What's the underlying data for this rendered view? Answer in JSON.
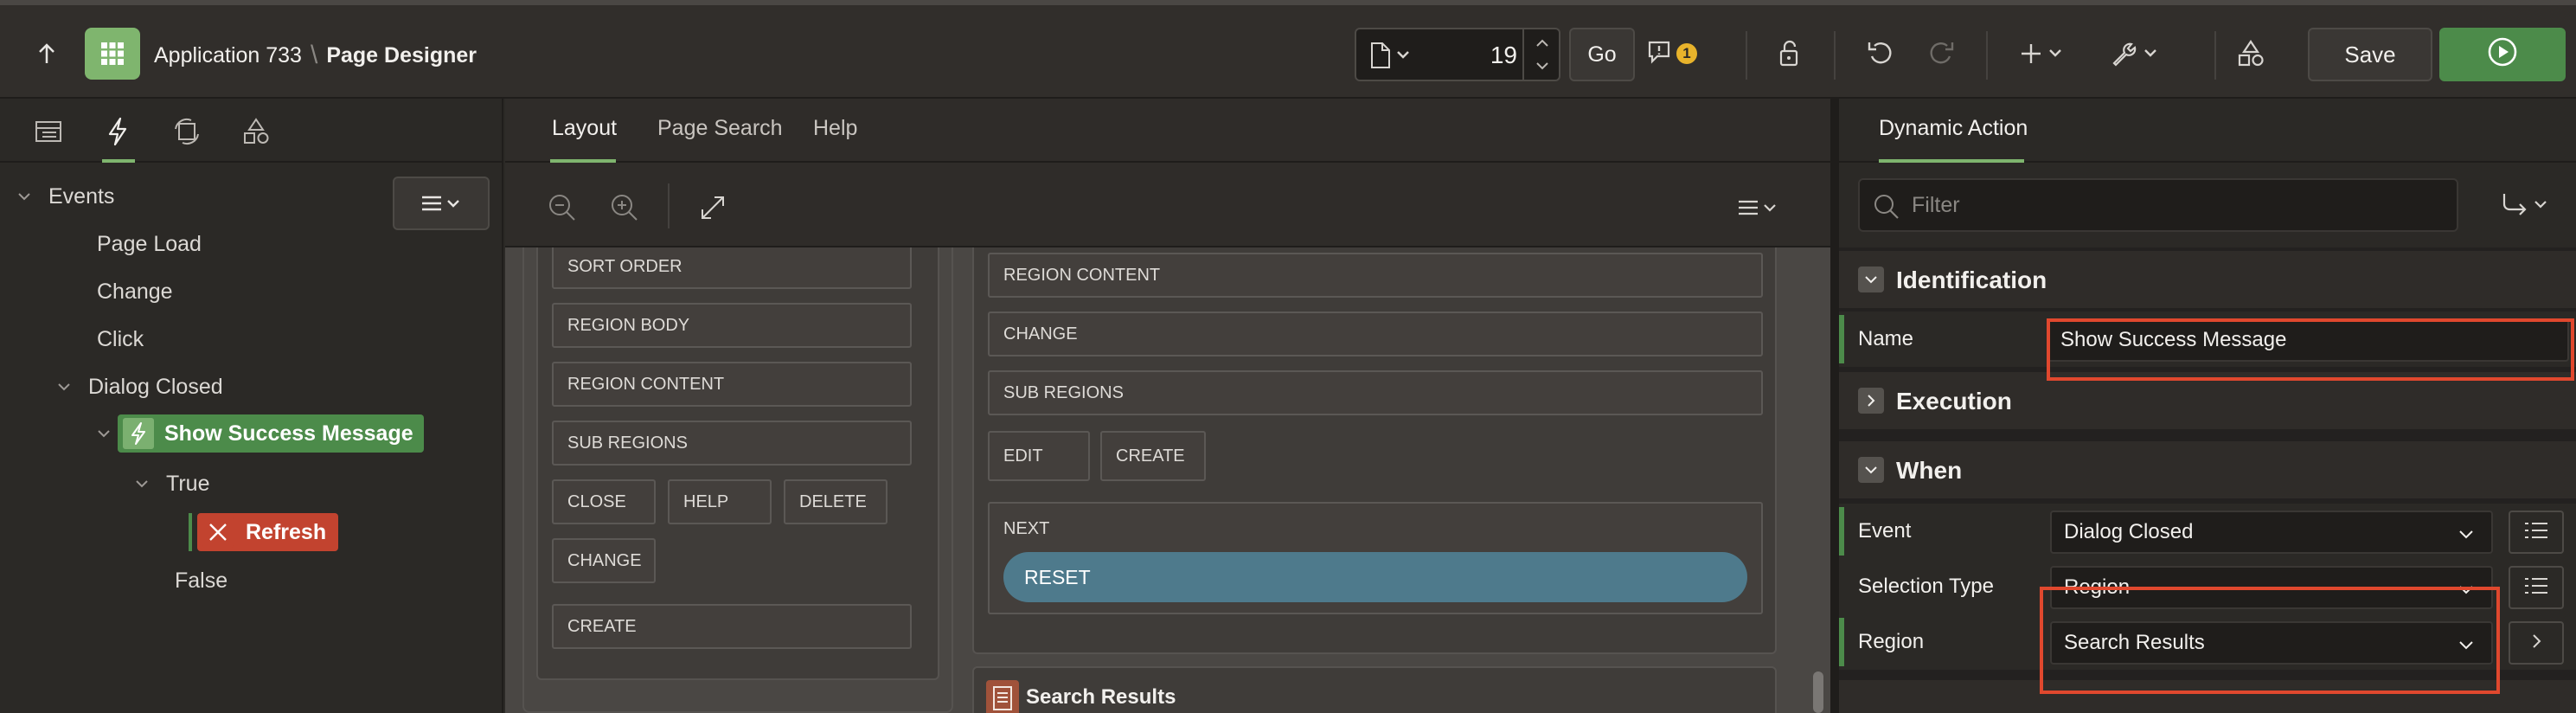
{
  "header": {
    "app_name": "Application 733",
    "separator": "\\",
    "page_designer": "Page Designer",
    "page_number": "19",
    "go_label": "Go",
    "messages_count": "1",
    "save_label": "Save"
  },
  "left_panel": {
    "tree": {
      "events": "Events",
      "page_load": "Page Load",
      "change": "Change",
      "click": "Click",
      "dialog_closed": "Dialog Closed",
      "show_success_message": "Show Success Message",
      "true_label": "True",
      "refresh": "Refresh",
      "false_label": "False"
    }
  },
  "center_panel": {
    "tabs": [
      "Layout",
      "Page Search",
      "Help"
    ],
    "col_a_slots": [
      "SORT ORDER",
      "REGION BODY",
      "REGION CONTENT",
      "SUB REGIONS",
      "CLOSE",
      "HELP",
      "DELETE",
      "CHANGE",
      "CREATE"
    ],
    "col_b_slots": [
      "REGION CONTENT",
      "CHANGE",
      "SUB REGIONS",
      "EDIT",
      "CREATE",
      "NEXT"
    ],
    "reset_label": "RESET",
    "search_results_title": "Search Results"
  },
  "right_panel": {
    "tab": "Dynamic Action",
    "filter_placeholder": "Filter",
    "sections": {
      "identification": "Identification",
      "execution": "Execution",
      "when": "When"
    },
    "properties": {
      "name_label": "Name",
      "name_value": "Show Success Message",
      "event_label": "Event",
      "event_value": "Dialog Closed",
      "selection_type_label": "Selection Type",
      "selection_type_value": "Region",
      "region_label": "Region",
      "region_value": "Search Results"
    }
  },
  "colors": {
    "accent_green": "#7fb56e",
    "run_green": "#4c8b4a",
    "error_red": "#c2432f",
    "highlight_red": "#e0482e",
    "button_blue": "#4e7a8c"
  }
}
